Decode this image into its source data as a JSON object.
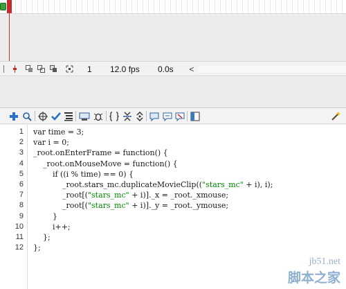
{
  "timeline": {
    "frame": "1",
    "fps": "12.0 fps",
    "elapsed": "0.0s",
    "scroll_left_glyph": "<"
  },
  "toolbar_icons": [
    "add-statement-icon",
    "find-icon",
    "insert-target-path-icon",
    "check-syntax-icon",
    "auto-format-icon",
    "show-code-hint-icon",
    "debug-options-icon",
    "collapse-between-braces-icon",
    "collapse-selection-icon",
    "expand-all-icon",
    "apply-block-comment-icon",
    "apply-line-comment-icon",
    "remove-comment-icon",
    "show-hide-toolbox-icon",
    "script-assist-icon"
  ],
  "code": {
    "line_numbers": [
      "1",
      "2",
      "3",
      "4",
      "5",
      "6",
      "7",
      "8",
      "9",
      "10",
      "11",
      "12"
    ],
    "lines": [
      {
        "pre": "var time = 3;"
      },
      {
        "pre": "var i = 0;"
      },
      {
        "pre": "_root.onEnterFrame = function() {"
      },
      {
        "pre": "    _root.onMouseMove = function() {"
      },
      {
        "pre": "        if ((i % time) == 0) {"
      },
      {
        "pre": "            _root.stars_mc.duplicateMovieClip((",
        "str": "\"stars_mc\"",
        "post": " + i), i);"
      },
      {
        "pre": "            _root[(",
        "str": "\"stars_mc\"",
        "post": " + i)]._x = _root._xmouse;"
      },
      {
        "pre": "            _root[(",
        "str": "\"stars_mc\"",
        "post": " + i)]._y = _root._ymouse;"
      },
      {
        "pre": "        }"
      },
      {
        "pre": "        i++;"
      },
      {
        "pre": "    };"
      },
      {
        "pre": "};"
      }
    ]
  },
  "colors": {
    "playhead": "#d23030",
    "string": "#008a00",
    "keyword": "#1a1aa6"
  },
  "watermark": {
    "site": "jb51.net",
    "name": "脚本之家"
  }
}
